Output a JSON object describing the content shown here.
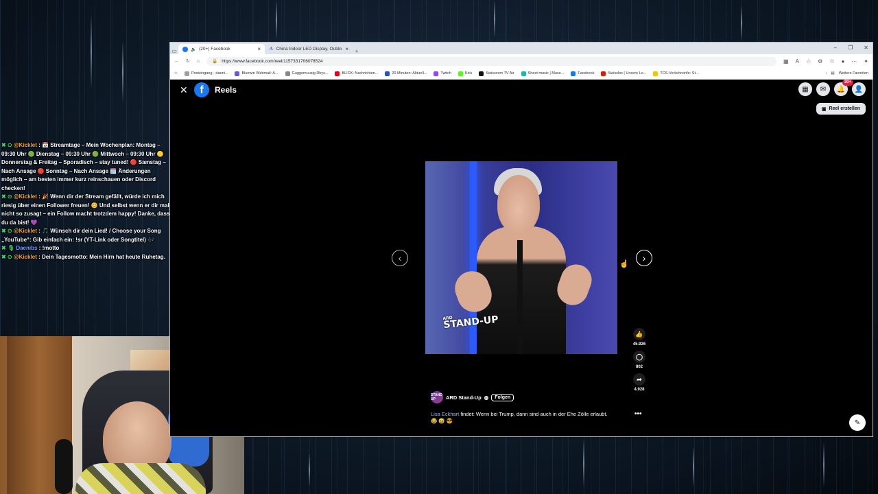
{
  "chat": [
    {
      "badge": "✖ ⊙",
      "user": "@Kicklet",
      "text": " : 📅 Streamtage – Mein Wochenplan: Montag – 09:30 Uhr 🟢 Dienstag – 09:30 Uhr 🟢 Mittwoch – 09:30 Uhr 🟡 Donnerstag & Freitag – Sporadisch – stay tuned! 🔴 Samstag – Nach Ansage 🔴 Sonntag – Nach Ansage 🗓️ Änderungen möglich – am besten immer kurz reinschauen oder Discord checken!"
    },
    {
      "badge": "✖ ⊙",
      "user": "@Kicklet",
      "text": " : 🎉 Wenn dir der Stream gefällt, würde ich mich riesig über einen Follower freuen! 😊 Und selbst wenn er dir mal nicht so zusagt – ein Follow macht trotzdem happy! Danke, dass du da bist! 💜"
    },
    {
      "badge": "✖ ⊙",
      "user": "@Kicklet",
      "text": " : 🎵 Wünsch dir dein Lied! / Choose your Song „YouTube“: Gib einfach ein: !sr (YT-Link oder Songtitel) 🎶"
    },
    {
      "badge": "✖ 🎙",
      "user": "Daenibs",
      "user_style": "blue",
      "text": " : !motto"
    },
    {
      "badge": "✖ ⊙",
      "user": "@Kicklet",
      "text": " : Dein Tagesmotto: Mein Hirn hat heute Ruhetag."
    }
  ],
  "browser": {
    "tabs": [
      {
        "label": "(20+) Facebook",
        "active": true
      },
      {
        "label": "China Indoor LED Display, Outdo",
        "active": false
      }
    ],
    "new_tab": "+",
    "url": "https://www.facebook.com/reel/1157331706078524",
    "bookmarks": [
      {
        "label": "Posteingang - daeni...",
        "color": "#9aa0a6"
      },
      {
        "label": "Bluewin Webmail: A...",
        "color": "#6a5acd"
      },
      {
        "label": "Guggemuusig Rhys...",
        "color": "#888"
      },
      {
        "label": "BLICK: Nachrichten...",
        "color": "#e2001a"
      },
      {
        "label": "20 Minuten: Aktuell...",
        "color": "#2155c4"
      },
      {
        "label": "Twitch",
        "color": "#9146ff"
      },
      {
        "label": "Kick",
        "color": "#53fc18"
      },
      {
        "label": "Swisscom TV Air",
        "color": "#111"
      },
      {
        "label": "Sheet music | Muse...",
        "color": "#1bb9a0"
      },
      {
        "label": "Facebook",
        "color": "#1877f2"
      },
      {
        "label": "Swisslos | Unsere Lo...",
        "color": "#d81e05"
      },
      {
        "label": "TCS-Verkehrsinfo: St...",
        "color": "#f5c400"
      }
    ],
    "more_favorites": "Weitere Favoriten"
  },
  "facebook": {
    "section_title": "Reels",
    "logo": "f",
    "notification_badge": "20+",
    "create_reel": "Reel erstellen",
    "video_logo_top": "ARD",
    "video_logo": "STAND-UP",
    "author": "ARD Stand-Up",
    "author_avatar": "STAND UP",
    "follow": "Folgen",
    "caption_mention": "Lisa Eckhart",
    "caption_text": " findet: Wenn bei Trump, dann sind auch in der Ehe Zölle erlaubt. 😂 😅 😎",
    "likes": "45.926",
    "comments": "802",
    "shares": "4.928"
  }
}
